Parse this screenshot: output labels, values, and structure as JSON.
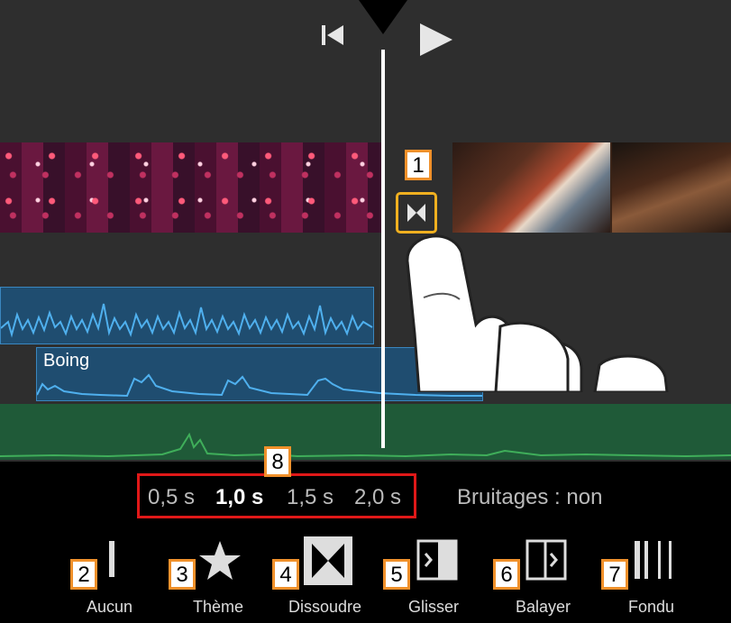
{
  "transport": {
    "skip_back_icon": "skip-to-start-icon",
    "play_icon": "play-icon"
  },
  "tracks": {
    "sound_clip_label": "Boing"
  },
  "transition_button_icon": "bowtie-transition-icon",
  "durations": {
    "options": [
      "0,5 s",
      "1,0 s",
      "1,5 s",
      "2,0 s"
    ],
    "selected": "1,0 s"
  },
  "sound_effects": "Bruitages : non",
  "transitions": [
    {
      "label": "Aucun",
      "icon": "none-bar-icon"
    },
    {
      "label": "Thème",
      "icon": "star-icon"
    },
    {
      "label": "Dissoudre",
      "icon": "dissolve-icon"
    },
    {
      "label": "Glisser",
      "icon": "slide-icon"
    },
    {
      "label": "Balayer",
      "icon": "wipe-icon"
    },
    {
      "label": "Fondu",
      "icon": "fade-icon"
    }
  ],
  "callouts": [
    "1",
    "2",
    "3",
    "4",
    "5",
    "6",
    "7",
    "8"
  ],
  "colors": {
    "accent_selection": "#f0b020",
    "callout_border": "#f0902a",
    "highlight_box": "#e01818",
    "audio_blue": "#3a9ad9",
    "audio_green": "#3fae5a"
  }
}
